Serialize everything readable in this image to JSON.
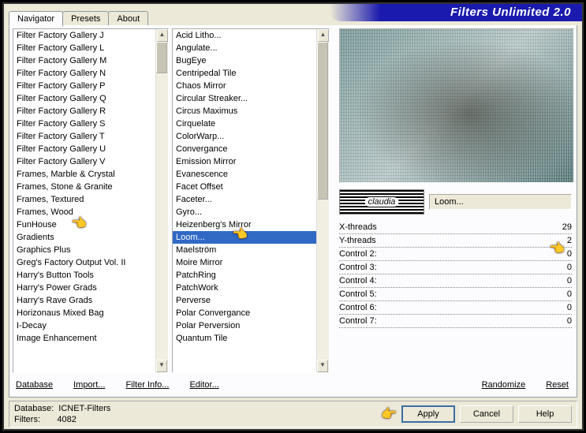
{
  "title": "Filters Unlimited 2.0",
  "tabs": [
    "Navigator",
    "Presets",
    "About"
  ],
  "activeTab": 0,
  "categories": [
    "Filter Factory Gallery J",
    "Filter Factory Gallery L",
    "Filter Factory Gallery M",
    "Filter Factory Gallery N",
    "Filter Factory Gallery P",
    "Filter Factory Gallery Q",
    "Filter Factory Gallery R",
    "Filter Factory Gallery S",
    "Filter Factory Gallery T",
    "Filter Factory Gallery U",
    "Filter Factory Gallery V",
    "Frames, Marble & Crystal",
    "Frames, Stone & Granite",
    "Frames, Textured",
    "Frames, Wood",
    "FunHouse",
    "Gradients",
    "Graphics Plus",
    "Greg's Factory Output Vol. II",
    "Harry's Button Tools",
    "Harry's Power Grads",
    "Harry's Rave Grads",
    "Horizonaus Mixed Bag",
    "I-Decay",
    "Image Enhancement"
  ],
  "filters": [
    "Acid Litho...",
    "Angulate...",
    "BugEye",
    "Centripedal Tile",
    "Chaos Mirror",
    "Circular Streaker...",
    "Circus Maximus",
    "Cirquelate",
    "ColorWarp...",
    "Convergance",
    "Emission Mirror",
    "Evanescence",
    "Facet Offset",
    "Faceter...",
    "Gyro...",
    "Heizenberg's Mirror",
    "Loom...",
    "Maelström",
    "Moire Mirror",
    "PatchRing",
    "PatchWork",
    "Perverse",
    "Polar Convergance",
    "Polar Perversion",
    "Quantum Tile"
  ],
  "selectedFilterIndex": 16,
  "currentFilterLabel": "Loom...",
  "controls": [
    {
      "label": "X-threads",
      "value": 29
    },
    {
      "label": "Y-threads",
      "value": 2
    },
    {
      "label": "Control 2:",
      "value": 0
    },
    {
      "label": "Control 3:",
      "value": 0
    },
    {
      "label": "Control 4:",
      "value": 0
    },
    {
      "label": "Control 5:",
      "value": 0
    },
    {
      "label": "Control 6:",
      "value": 0
    },
    {
      "label": "Control 7:",
      "value": 0
    }
  ],
  "links": {
    "database": "Database",
    "import": "Import...",
    "filterInfo": "Filter Info...",
    "editor": "Editor...",
    "randomize": "Randomize",
    "reset": "Reset"
  },
  "status": {
    "dbLabel": "Database:",
    "dbValue": "ICNET-Filters",
    "filtersLabel": "Filters:",
    "filtersValue": "4082"
  },
  "buttons": {
    "apply": "Apply",
    "cancel": "Cancel",
    "help": "Help"
  },
  "logo": "claudia"
}
